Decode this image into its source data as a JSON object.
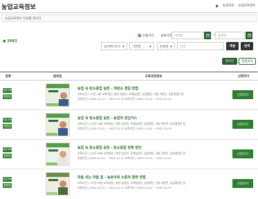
{
  "header": {
    "title": "농업교육정보",
    "breadcrumb": [
      "농업교육",
      "농업교육정보"
    ]
  },
  "intro": "농업교육정보 안내를 합니다.",
  "filters": {
    "radio_apply_period": "신청기간",
    "radio_edu_period": "교육기간",
    "start_placeholder": "시작일",
    "end_placeholder": "종료일",
    "tilde": "~",
    "total_count": "368건",
    "select_1": "10개씩 보기",
    "select_2": "기관명",
    "select_3": "분류명",
    "search_placeholder": "검색",
    "reset_label": "재설",
    "search_label": "검색"
  },
  "view_tabs": {
    "online": "온라인",
    "offline": "집합교육"
  },
  "table": {
    "headers": {
      "category": "분류",
      "thumbnail": "썸네일",
      "info": "교육과정정보",
      "apply": "신청하기"
    },
    "rows": [
      {
        "badge1": "이론교육",
        "badge2": "동영상",
        "title": "농업 속 탄소중립 실천 - 저탄소 경갈 방법",
        "meta1": "교육시간 | 1시간 0분   교육대상 | 청년 농업인, 후계농업인, 농업법인, 귀농·귀촌인, 농업경영인 등",
        "meta2": "신청기간 | 2022-12-01 ~ 2022-12-31   교육기간 | 2022-12-01 ~ 2022-12-31",
        "apply": "신청하기"
      },
      {
        "badge1": "이론교육",
        "badge2": "동영상",
        "title": "농업 속 탄소중립 실천 - 농업과 관심가스",
        "meta1": "교육시간 | 1시간 10분   교육대상 | 청년 농업인, 후계농업인, 농업법인, 귀농·귀촌인, 농업경영인 등",
        "meta2": "신청기간 | 2022-12-01 ~ 2022-12-31   교육기간 | 2022-12-01 ~ 2022-12-31",
        "apply": "신청하기"
      },
      {
        "badge1": "이론교육",
        "badge2": "동영상",
        "title": "농업 속 탄소중립 실천 - 탄소중립 정책 방안",
        "meta1": "교육시간 | 1시간 40분   교육대상 | 청년 농업인, 후계농업인, 농업법인, 귀농·귀촌인, 농업경영인 등",
        "meta2": "신청기간 | 2022-12-01 ~ 2022-12-31   교육기간 | 2022-12-01 ~ 2022-12-31",
        "apply": "신청하기"
      },
      {
        "badge1": "이론교육",
        "badge2": "동영상",
        "title": "마을 쉬는 마을 집 - 농촌사회 소통과 협력 방법",
        "meta1": "교육시간 | 1시간 55분   교육대상 | 청년 농업인, 후계농업인, 농업법인, 귀농·귀촌인, 농업경영인 등",
        "meta2": "신청기간 | 2022-12-01 ~ 2022-12-31   교육기간 | 2022-12-01 ~ 2022-12-31",
        "apply": "신청하기"
      }
    ]
  },
  "colors": {
    "brand_green": "#2e7d32",
    "dark_green": "#2e5e33",
    "title_green": "#2e6b33"
  }
}
